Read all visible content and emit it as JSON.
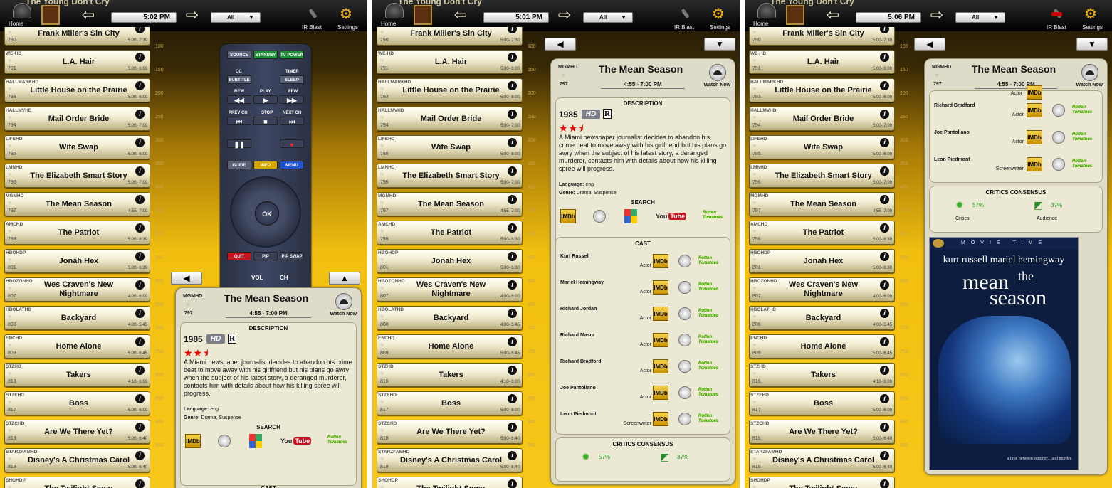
{
  "toolbar": {
    "now_playing": "The Young Don't Cry",
    "home_label": "Home",
    "irblast_label": "IR Blast",
    "settings_label": "Settings",
    "filter": "All"
  },
  "shots": [
    {
      "time": "5:02 PM"
    },
    {
      "time": "5:01 PM"
    },
    {
      "time": "5:06 PM"
    }
  ],
  "channels": [
    {
      "call": "IFC HD",
      "num": "790",
      "title": "Frank Miller's Sin City",
      "time": "5:00- 7:30"
    },
    {
      "call": "WE-HD",
      "num": "791",
      "title": "L.A. Hair",
      "time": "5:00- 6:00"
    },
    {
      "call": "HALLMARKHD",
      "num": "793",
      "title": "Little House on the Prairie",
      "time": "5:00- 6:00"
    },
    {
      "call": "HALLMVHD",
      "num": "794",
      "title": "Mail Order Bride",
      "time": "5:00- 7:00"
    },
    {
      "call": "LIFEHD",
      "num": "795",
      "title": "Wife Swap",
      "time": "5:00- 6:00"
    },
    {
      "call": "LMNHD",
      "num": "796",
      "title": "The Elizabeth Smart Story",
      "time": "5:00- 7:00"
    },
    {
      "call": "MGMHD",
      "num": "797",
      "title": "The Mean Season",
      "time": "4:55- 7:00"
    },
    {
      "call": "AMCHD",
      "num": "798",
      "title": "The Patriot",
      "time": "5:00- 8:30"
    },
    {
      "call": "HBOHDP",
      "num": "801",
      "title": "Jonah Hex",
      "time": "5:00- 6:30"
    },
    {
      "call": "HBOZONHD",
      "num": "807",
      "title": "Wes Craven's New Nightmare",
      "time": "4:00- 6:00"
    },
    {
      "call": "HBOLATHD",
      "num": "808",
      "title": "Backyard",
      "time": "4:00- 5:45"
    },
    {
      "call": "ENCHD",
      "num": "809",
      "title": "Home Alone",
      "time": "5:00- 6:45"
    },
    {
      "call": "STZHD",
      "num": "816",
      "title": "Takers",
      "time": "4:10- 6:00"
    },
    {
      "call": "STZEHD",
      "num": "817",
      "title": "Boss",
      "time": "5:00- 6:00"
    },
    {
      "call": "STZCHD",
      "num": "818",
      "title": "Are We There Yet?",
      "time": "5:00- 6:40"
    },
    {
      "call": "STARZFAMHD",
      "num": "819",
      "title": "Disney's A Christmas Carol",
      "time": "5:00- 6:40"
    },
    {
      "call": "SHOHDP",
      "num": "",
      "title": "The Twilight Saga:",
      "time": ""
    }
  ],
  "ruler_ticks": [
    "100",
    "150",
    "200",
    "250",
    "300",
    "350",
    "400",
    "450",
    "500",
    "550",
    "600",
    "650",
    "700",
    "750",
    "800",
    "850",
    "900",
    "950"
  ],
  "remote": {
    "source": "SOURCE",
    "standby": "STANDBY",
    "tv_power": "TV POWER",
    "cc": "CC",
    "subtitle": "SUBTITLE",
    "timer": "TIMER",
    "sleep": "SLEEP",
    "rew": "REW",
    "play": "PLAY",
    "ffw": "FFW",
    "prev": "PREV CH",
    "stop": "STOP",
    "next": "NEXT CH",
    "guide": "GUIDE",
    "info": "INFO",
    "menu": "MENU",
    "ok": "OK",
    "quit": "QUIT",
    "pip": "PIP",
    "pip_swap": "PIP SWAP",
    "vol": "VOL",
    "ch": "CH"
  },
  "program": {
    "call": "MGMHD",
    "num": "797",
    "title": "The Mean Season",
    "time": "4:55 - 7:00 PM",
    "watch_label": "Watch Now",
    "description_header": "DESCRIPTION",
    "year": "1985",
    "hd": "HD",
    "rating": "R",
    "stars": "★★⯨",
    "description": "A Miami newspaper journalist decides to abandon his crime beat to move away with his girlfriend but his plans go awry when the subject of his latest story, a deranged murderer, contacts him with details about how his killing spree will progress.",
    "language_label": "Language:",
    "language": "eng",
    "genre_label": "Genre:",
    "genre": "Drama, Suspense",
    "search_header": "SEARCH",
    "cast_header": "CAST",
    "critics_header": "CRITICS CONSENSUS",
    "critics_pct": "57%",
    "critics_label": "Critics",
    "audience_pct": "37%",
    "audience_label": "Audience",
    "imdb": "IMDb",
    "youtube_a": "You",
    "youtube_b": "Tube",
    "rt": "Rotten Tomatoes",
    "cast": [
      {
        "name": "Kurt Russell",
        "role": "Actor"
      },
      {
        "name": "Mariel Hemingway",
        "role": "Actor"
      },
      {
        "name": "Richard Jordan",
        "role": "Actor"
      },
      {
        "name": "Richard Masur",
        "role": "Actor"
      },
      {
        "name": "Richard Bradford",
        "role": "Actor"
      },
      {
        "name": "Joe Pantoliano",
        "role": "Actor"
      },
      {
        "name": "Leon Piedmont",
        "role": "Screenwriter"
      }
    ],
    "cast_partial_role": "Actor",
    "poster": {
      "banner": "MOVIE TIME",
      "actors": "kurt russell mariel hemingway",
      "the": "the",
      "t1": "mean",
      "t2": "season",
      "tagline": "a time between summer... and murder."
    }
  },
  "colors": {
    "gold": "#f2bf10",
    "accent_red": "#c8141c",
    "accent_green": "#1f8f3a"
  }
}
